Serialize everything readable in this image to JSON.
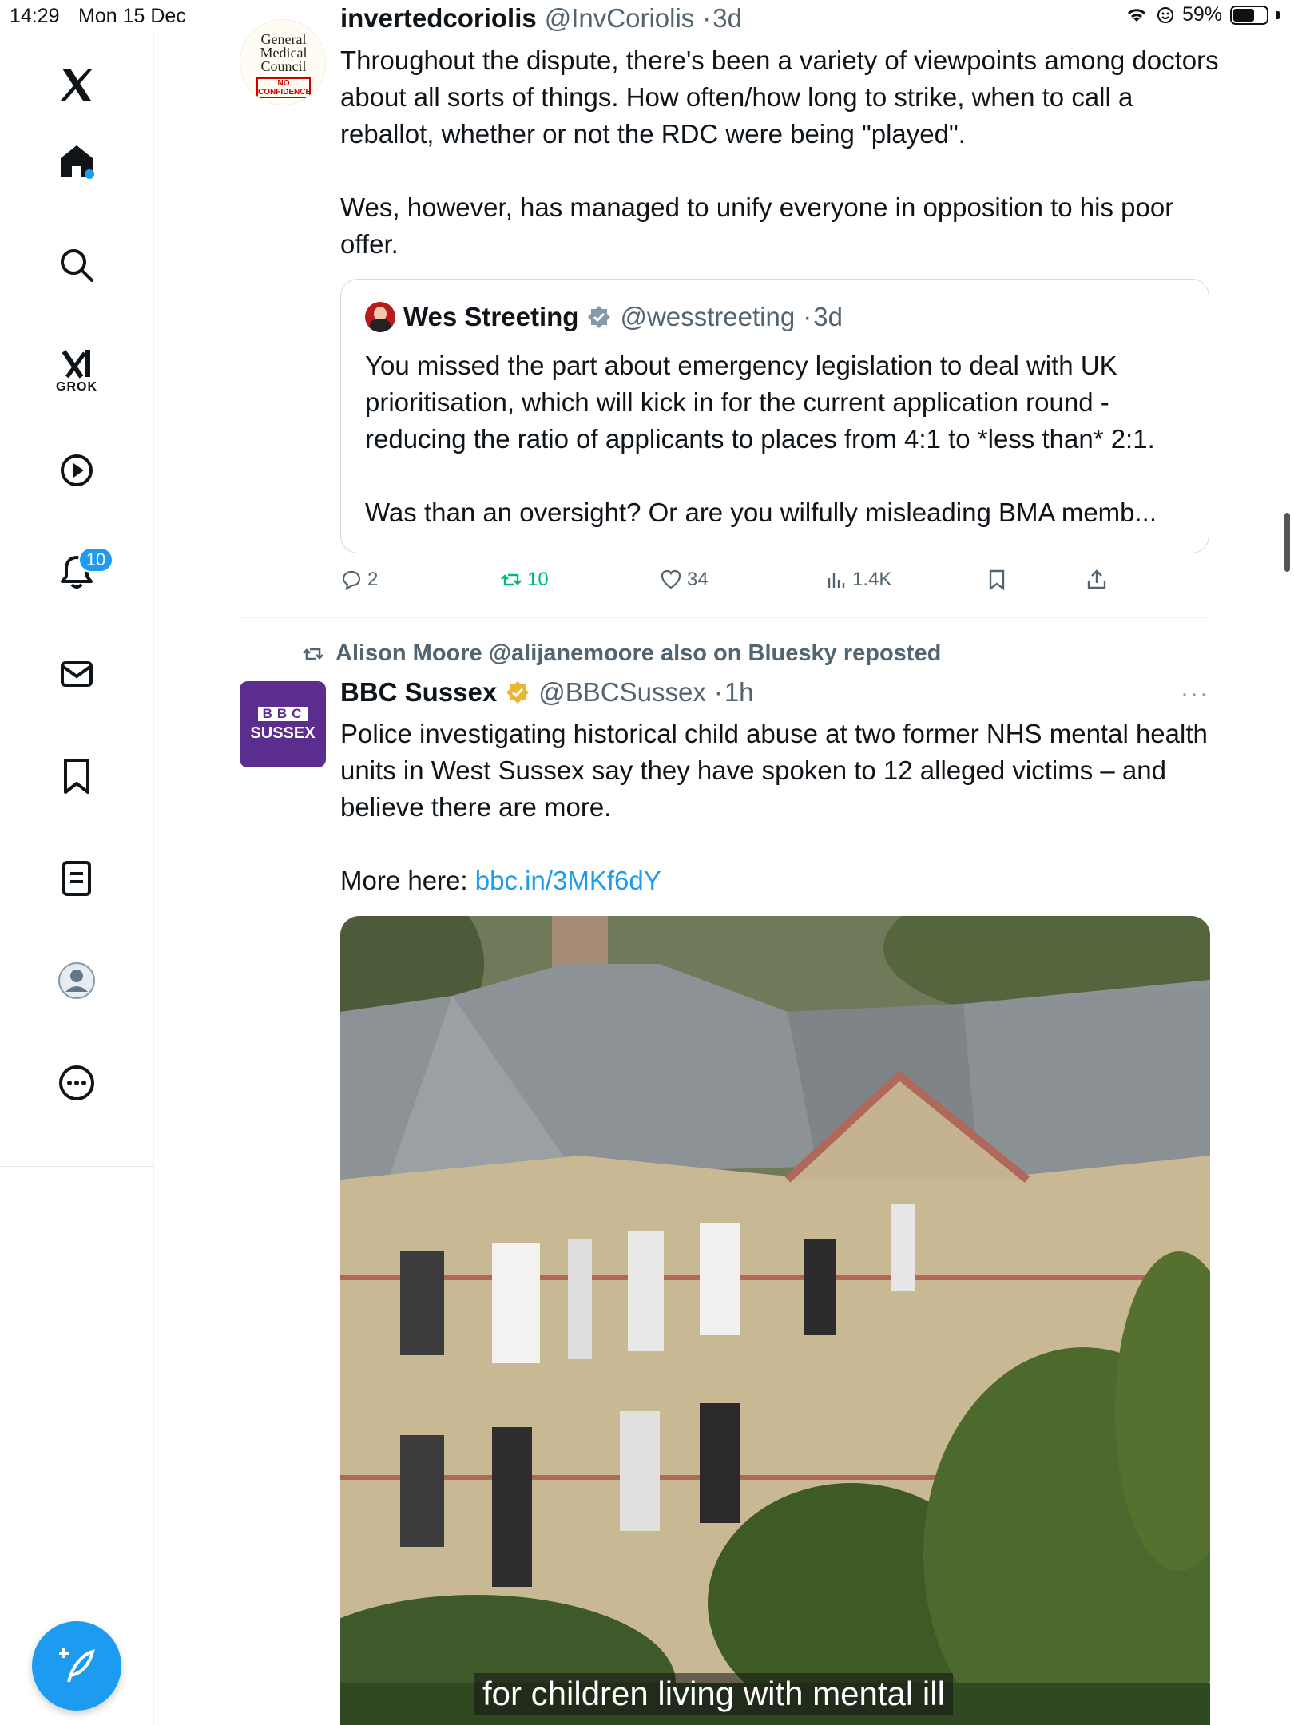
{
  "status_bar": {
    "time": "14:29",
    "date": "Mon 15 Dec",
    "battery": "59%"
  },
  "sidebar": {
    "grok_label": "GROK",
    "notifications_count": "10"
  },
  "tweet1": {
    "avatar_text": {
      "line1": "General",
      "line2": "Medical",
      "line3": "Council",
      "stamp1": "NO",
      "stamp2": "CONFIDENCE"
    },
    "name": "invertedcoriolis",
    "handle": "@InvCoriolis",
    "time": "3d",
    "text_p1": "Throughout the dispute, there's been a variety of viewpoints among doctors about all sorts of things. How often/how long to strike, when to call a reballot, whether or not the RDC were being \"played\".",
    "text_p2": "Wes, however, has managed to unify everyone in opposition to his poor offer.",
    "quote": {
      "name": "Wes Streeting",
      "handle": "@wesstreeting",
      "time": "3d",
      "text_p1": "You missed the part about emergency legislation to deal with UK prioritisation, which will kick in for the current application round - reducing the ratio of applicants to places from 4:1 to *less than* 2:1.",
      "text_p2": "Was than an oversight? Or are you wilfully misleading BMA memb..."
    },
    "actions": {
      "replies": "2",
      "reposts": "10",
      "likes": "34",
      "views": "1.4K"
    }
  },
  "tweet2": {
    "repost_by": "Alison Moore @alijanemoore also on Bluesky reposted",
    "avatar_text": {
      "line1": "BBC",
      "line2": "SUSSEX"
    },
    "name": "BBC Sussex",
    "handle": "@BBCSussex",
    "time": "1h",
    "text_p1": "Police investigating historical child abuse at two former NHS mental health units in West Sussex say they have spoken to 12 alleged victims – and believe there are more.",
    "text_p2_prefix": "More here: ",
    "link": "bbc.in/3MKf6dY",
    "media_caption": "for children living with mental ill"
  },
  "colors": {
    "accent": "#1d9bf0",
    "repost_green": "#00ba7c",
    "bbc_purple": "#5b2d8e",
    "secondary_text": "#536471"
  }
}
